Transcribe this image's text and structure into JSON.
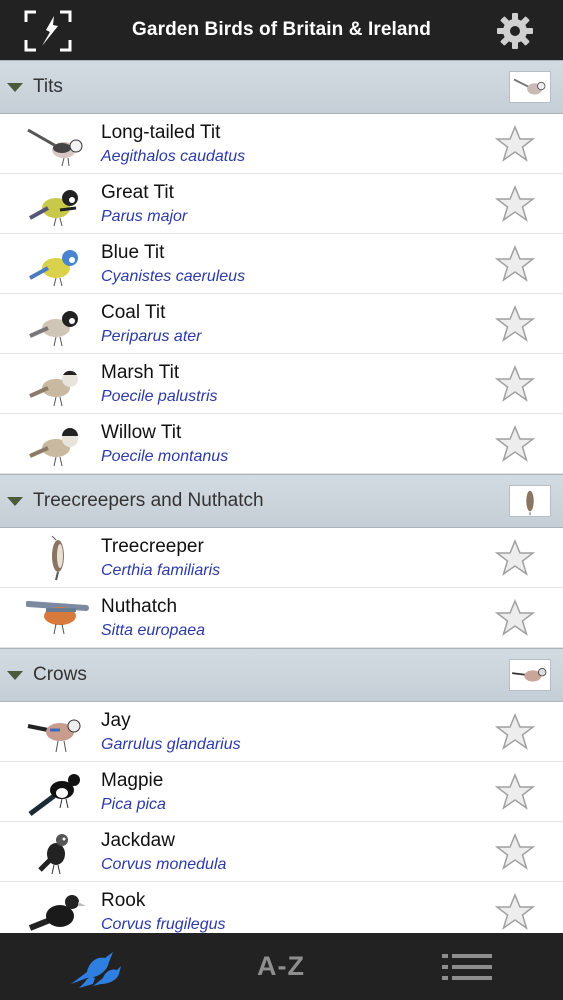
{
  "header": {
    "title": "Garden Birds of Britain & Ireland"
  },
  "sections": [
    {
      "label": "Tits",
      "birds": [
        {
          "name": "Long-tailed Tit",
          "latin": "Aegithalos caudatus"
        },
        {
          "name": "Great Tit",
          "latin": "Parus major"
        },
        {
          "name": "Blue Tit",
          "latin": "Cyanistes caeruleus"
        },
        {
          "name": "Coal Tit",
          "latin": "Periparus ater"
        },
        {
          "name": "Marsh Tit",
          "latin": "Poecile palustris"
        },
        {
          "name": "Willow Tit",
          "latin": "Poecile montanus"
        }
      ]
    },
    {
      "label": "Treecreepers and Nuthatch",
      "birds": [
        {
          "name": "Treecreeper",
          "latin": "Certhia familiaris"
        },
        {
          "name": "Nuthatch",
          "latin": "Sitta europaea"
        }
      ]
    },
    {
      "label": "Crows",
      "birds": [
        {
          "name": "Jay",
          "latin": "Garrulus glandarius"
        },
        {
          "name": "Magpie",
          "latin": "Pica pica"
        },
        {
          "name": "Jackdaw",
          "latin": "Corvus monedula"
        },
        {
          "name": "Rook",
          "latin": "Corvus frugilegus"
        }
      ]
    }
  ],
  "tabs": {
    "az_label": "A-Z"
  },
  "colors": {
    "bar": "#222222",
    "latin_text": "#2b3aa8",
    "section_bg": "#cfd7de",
    "active_tab": "#2f7fe0"
  }
}
